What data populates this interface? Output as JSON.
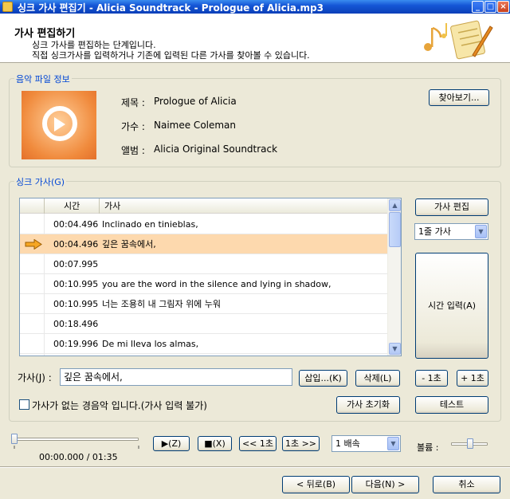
{
  "window": {
    "title": "싱크 가사 편집기 - Alicia Soundtrack - Prologue of Alicia.mp3",
    "minimize": "_",
    "maximize": "□",
    "close": "×"
  },
  "header": {
    "title": "가사 편집하기",
    "line1": "싱크 가사를 편집하는 단계입니다.",
    "line2": "직접 싱크가사를 입력하거나 기존에 입력된 다른 가사를 찾아볼 수 있습니다."
  },
  "music_info": {
    "legend": "음악 파일 정보",
    "title_label": "제목 :",
    "title_value": "Prologue of Alicia",
    "artist_label": "가수 :",
    "artist_value": "Naimee Coleman",
    "album_label": "앨범 :",
    "album_value": "Alicia Original Soundtrack",
    "browse_button": "찾아보기..."
  },
  "sync_lyrics": {
    "legend": "싱크 가사(G)",
    "columns": [
      "시간",
      "가사"
    ],
    "rows": [
      {
        "time": "00:04.496",
        "lyric": "Inclinado en tinieblas,"
      },
      {
        "time": "00:04.496",
        "lyric": "깊은 꿈속에서,",
        "selected": true
      },
      {
        "time": "00:07.995",
        "lyric": ""
      },
      {
        "time": "00:10.995",
        "lyric": "you are the word in the silence and lying in shadow,"
      },
      {
        "time": "00:10.995",
        "lyric": "너는 조용히 내 그림자 위에 누워"
      },
      {
        "time": "00:18.496",
        "lyric": ""
      },
      {
        "time": "00:19.996",
        "lyric": "De mi lleva los almas,"
      }
    ],
    "edit_button": "가사 편집",
    "line_mode": "1줄 가사",
    "time_input_button": "시간 입력(A)",
    "minus_button": "- 1초",
    "plus_button": "+ 1초",
    "test_button": "테스트",
    "lyric_label": "가사(J) :",
    "lyric_value": "깊은 꿈속에서,",
    "insert_button": "삽입...(K)",
    "delete_button": "삭제(L)",
    "no_lyrics_checkbox_label": "가사가 없는 경음악 입니다.(가사 입력 불가)",
    "reset_button": "가사 초기화"
  },
  "player": {
    "time": "00:00.000 / 01:35",
    "progress": 0,
    "play_button": "▶(Z)",
    "stop_button": "■(X)",
    "back_button": "<< 1초",
    "forward_button": "1초 >>",
    "speed": "1 배속",
    "volume_label": "볼륨 :",
    "volume": 0.75
  },
  "footer": {
    "back_button": "< 뒤로(B)",
    "next_button": "다음(N) >",
    "cancel_button": "취소"
  },
  "colors": {
    "accent": "#0046d5",
    "selected_row": "#fdd9ae",
    "titlebar": "#1556d6"
  }
}
